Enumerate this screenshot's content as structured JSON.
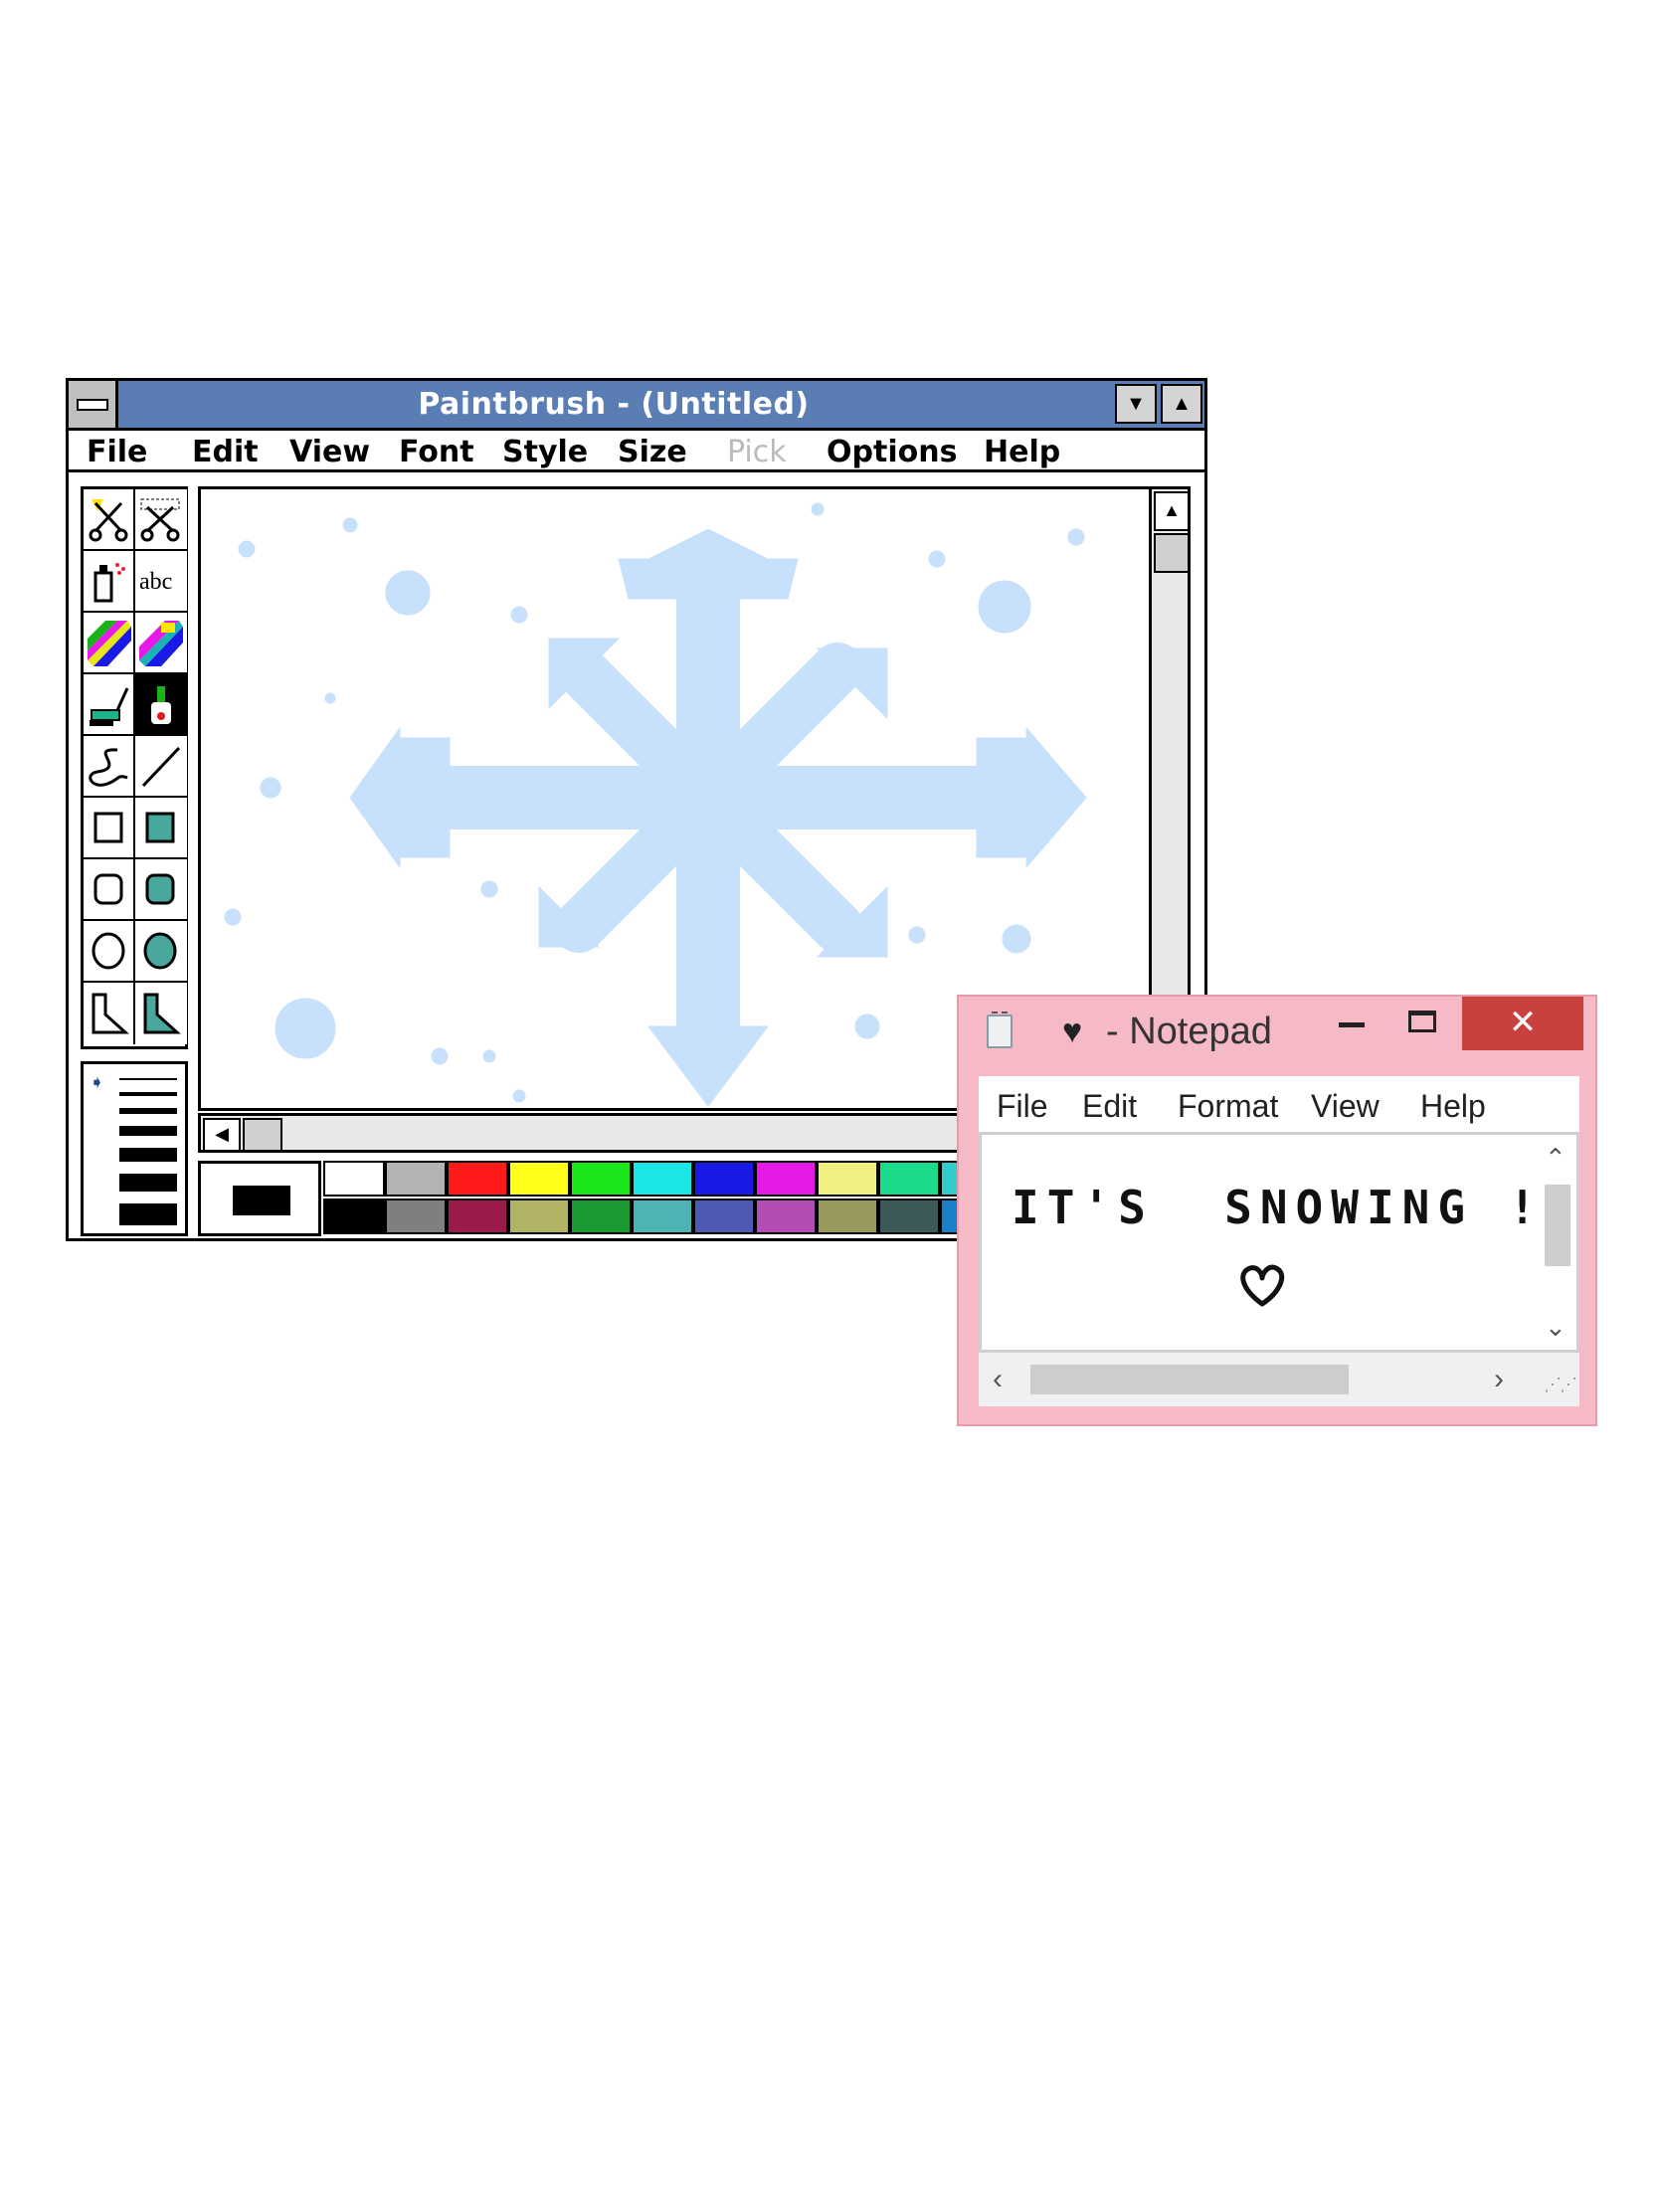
{
  "paintbrush": {
    "title": "Paintbrush - (Untitled)",
    "menus": [
      "File",
      "Edit",
      "View",
      "Font",
      "Style",
      "Size",
      "Pick",
      "Options",
      "Help"
    ],
    "disabled_menu": "Pick",
    "canvas_color": "#c7e0fb",
    "palette": {
      "top": [
        "#ffffff",
        "#b3b3b3",
        "#ff1a1a",
        "#ffff1a",
        "#1ae61a",
        "#1ae6e6",
        "#1a1ae6",
        "#e61ae6",
        "#f0f080",
        "#1adb8a",
        "#33cccc"
      ],
      "bottom": [
        "#000000",
        "#7f7f7f",
        "#9a1a4a",
        "#b3b366",
        "#1a9a33",
        "#4db3b3",
        "#4d59b3",
        "#b34db3",
        "#99995e",
        "#3d5a5a",
        "#1a80cc"
      ]
    },
    "tools": [
      "scissors-icon",
      "pick-scissors-icon",
      "airbrush-icon",
      "text-tool-icon",
      "color-eraser-icon",
      "eraser-icon",
      "paint-roller-icon",
      "brush-icon",
      "curve-icon",
      "line-icon",
      "box-icon",
      "filled-box-icon",
      "rounded-box-icon",
      "filled-rounded-box-icon",
      "circle-icon",
      "filled-circle-icon",
      "polygon-icon",
      "filled-polygon-icon"
    ]
  },
  "notepad": {
    "title_heart": "♥",
    "title": "- Notepad",
    "menus": [
      "File",
      "Edit",
      "Format",
      "View",
      "Help"
    ],
    "text": "IT'S  SNOWING !",
    "close": "✕",
    "accent": "#f6b9c6",
    "close_color": "#c9413d"
  }
}
